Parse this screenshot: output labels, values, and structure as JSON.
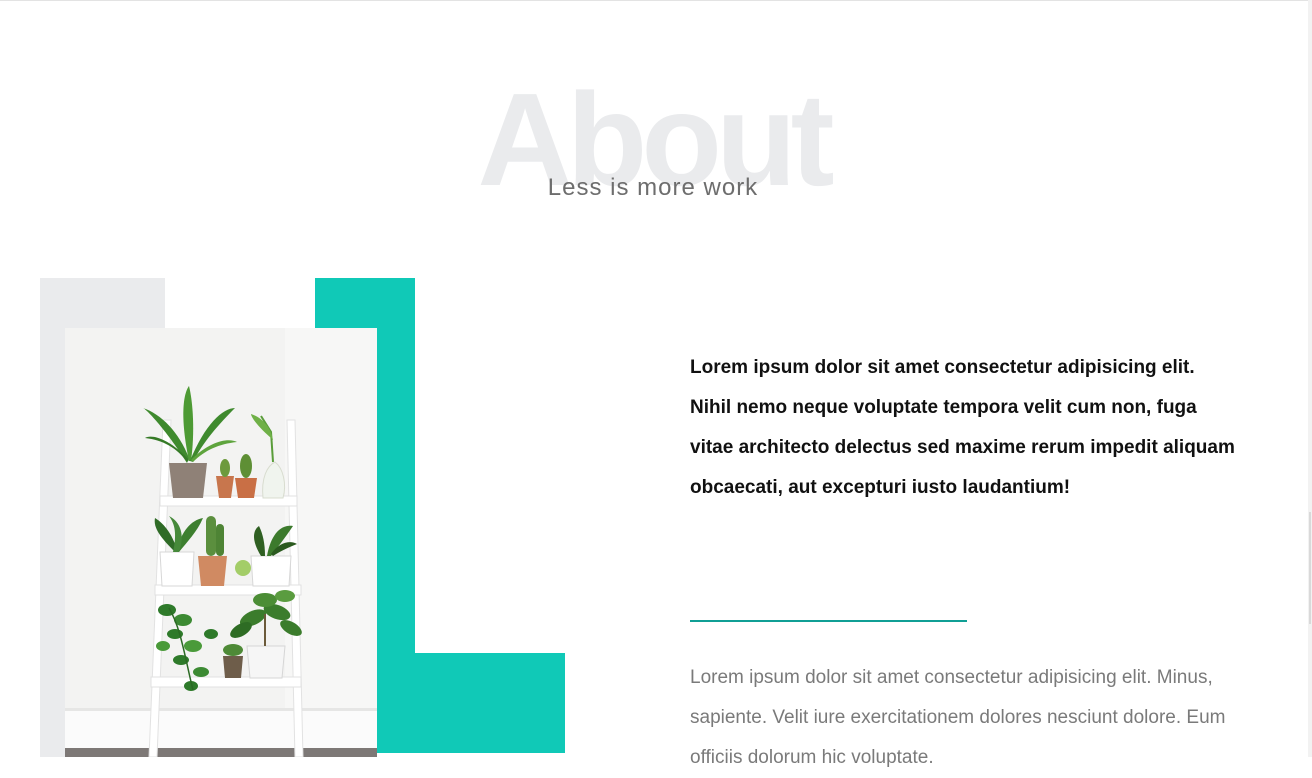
{
  "colors": {
    "accent": "#10c9b7",
    "divider": "#109f95",
    "muted_block": "#eaebed",
    "heading_ghost": "#eaebed"
  },
  "about": {
    "bg_title": "About",
    "subtitle": "Less is more work",
    "lead": "Lorem ipsum dolor sit amet consectetur adipisicing elit. Nihil nemo neque voluptate tempora velit cum non, fuga vitae architecto delectus sed maxime rerum impedit aliquam obcaecati, aut excepturi iusto laudantium!",
    "body": "Lorem ipsum dolor sit amet consectetur adipisicing elit. Minus, sapiente. Velit iure exercitationem dolores nesciunt dolore. Eum officiis dolorum hic voluptate."
  }
}
